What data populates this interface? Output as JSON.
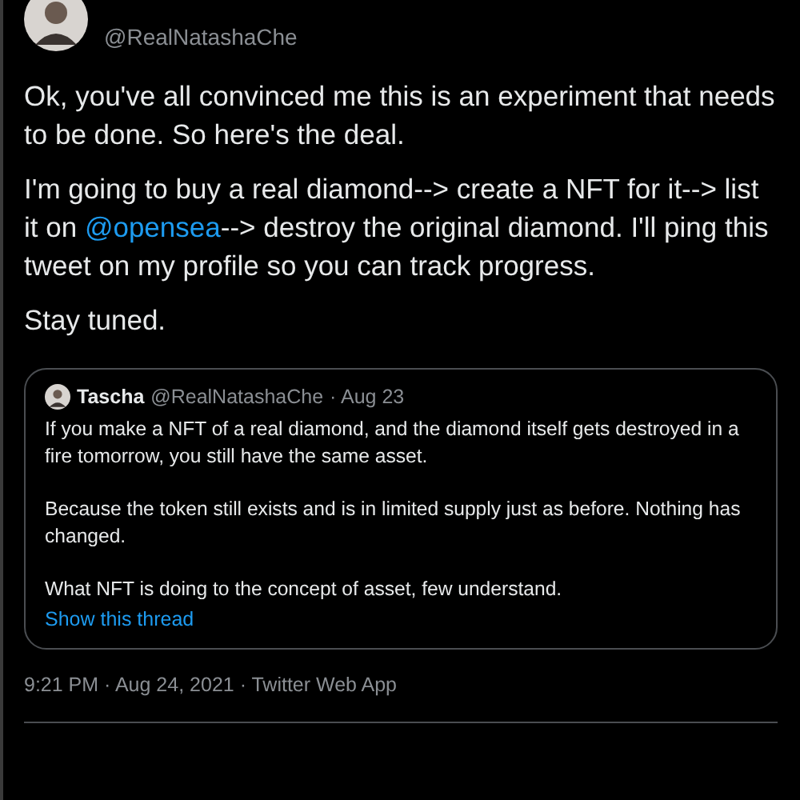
{
  "tweet": {
    "handle": "@RealNatashaChe",
    "paragraphs": [
      {
        "parts": [
          {
            "text": "Ok, you've all convinced me this is an experiment that needs to be done. So here's the deal.",
            "kind": "plain"
          }
        ]
      },
      {
        "parts": [
          {
            "text": "I'm going to buy a real diamond--> create a NFT for it--> list it on ",
            "kind": "plain"
          },
          {
            "text": "@opensea",
            "kind": "mention"
          },
          {
            "text": "--> destroy the original diamond. I'll ping this tweet on my profile so you can track progress.",
            "kind": "plain"
          }
        ]
      },
      {
        "parts": [
          {
            "text": "Stay tuned.",
            "kind": "plain"
          }
        ]
      }
    ],
    "quote": {
      "name": "Tascha",
      "handle": "@RealNatashaChe",
      "date": "· Aug 23",
      "paragraphs": [
        "If you make a NFT of a real diamond, and the diamond itself gets destroyed in a fire tomorrow, you still have the same asset.",
        "Because the token still exists and is in limited supply just as before. Nothing has changed.",
        "What NFT is doing to the concept of asset, few understand."
      ],
      "link": "Show this thread"
    },
    "meta": "9:21 PM · Aug 24, 2021 · Twitter Web App"
  }
}
